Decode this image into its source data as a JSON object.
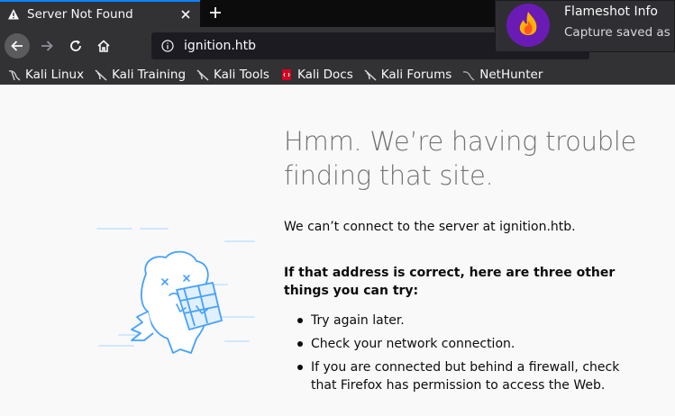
{
  "tab": {
    "title": "Server Not Found"
  },
  "urlbar": {
    "url": "ignition.htb"
  },
  "bookmarks": [
    {
      "label": "Kali Linux",
      "icon": "kali-dragon-icon"
    },
    {
      "label": "Kali Training",
      "icon": "kali-dragon-icon"
    },
    {
      "label": "Kali Tools",
      "icon": "kali-dragon-icon"
    },
    {
      "label": "Kali Docs",
      "icon": "kali-docs-icon"
    },
    {
      "label": "Kali Forums",
      "icon": "kali-dragon-icon"
    },
    {
      "label": "NetHunter",
      "icon": "nethunter-icon"
    }
  ],
  "notification": {
    "title": "Flameshot Info",
    "body": "Capture saved as .p"
  },
  "error": {
    "heading": "Hmm. We’re having trouble finding that site.",
    "lead": "We can’t connect to the server at ignition.htb.",
    "subheading": "If that address is correct, here are three other things you can try:",
    "tips": [
      "Try again later.",
      "Check your network connection.",
      "If you are connected but behind a firewall, check that Firefox has permission to access the Web."
    ]
  },
  "colors": {
    "tab_accent": "#0a84ff",
    "chrome": "#323234",
    "page_bg": "#f9f9fa",
    "illustration": "#45a1ff"
  }
}
